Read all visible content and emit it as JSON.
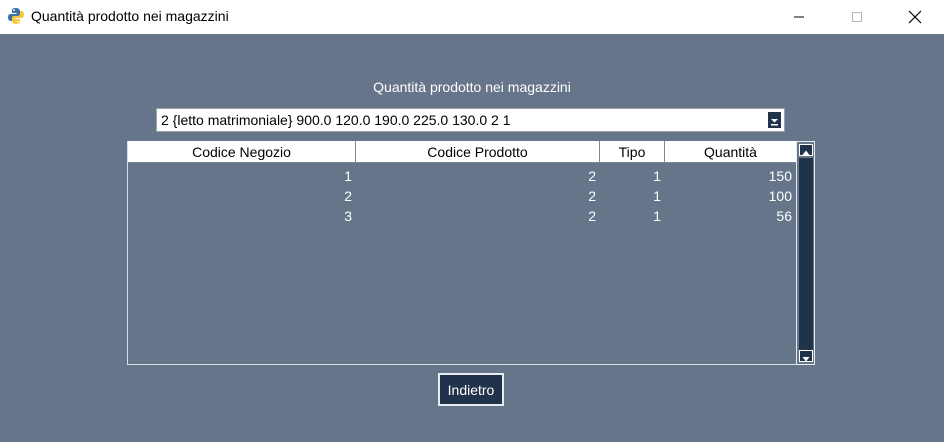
{
  "window": {
    "title": "Quantità prodotto nei magazzini",
    "icon": "python-icon"
  },
  "heading": "Quantità prodotto nei magazzini",
  "product_select": {
    "selected": "2 {letto matrimoniale} 900.0 120.0 190.0 225.0 130.0 2 1"
  },
  "table": {
    "columns": [
      "Codice Negozio",
      "Codice Prodotto",
      "Tipo",
      "Quantità"
    ],
    "rows": [
      [
        "1",
        "2",
        "1",
        "150"
      ],
      [
        "2",
        "2",
        "1",
        "100"
      ],
      [
        "3",
        "2",
        "1",
        "56"
      ]
    ]
  },
  "back_button": "Indietro",
  "colors": {
    "background": "#667589",
    "control_dark": "#21324b",
    "text_light": "#ffffff"
  }
}
